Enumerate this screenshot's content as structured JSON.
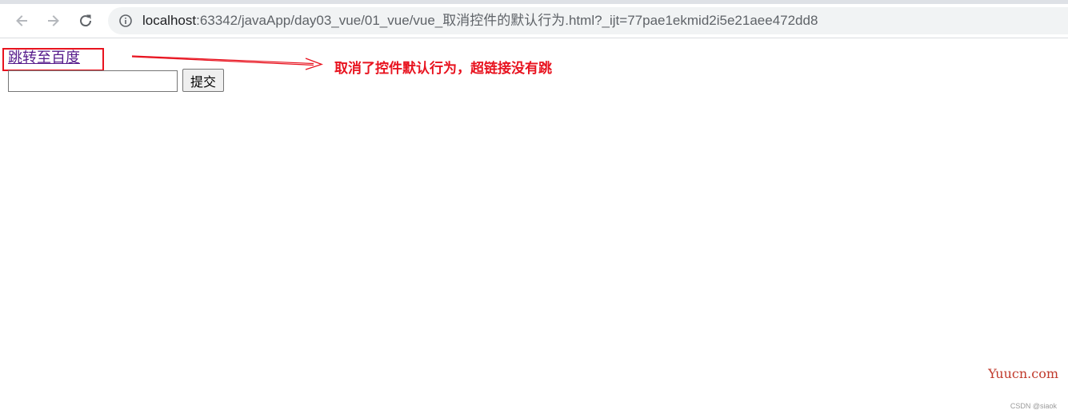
{
  "browser": {
    "url_host": "localhost",
    "url_rest": ":63342/javaApp/day03_vue/01_vue/vue_取消控件的默认行为.html?_ijt=77pae1ekmid2i5e21aee472dd8",
    "icons": {
      "back": "arrow-left-icon",
      "forward": "arrow-right-icon",
      "reload": "reload-icon",
      "info": "info-icon"
    }
  },
  "page": {
    "link_text": "跳转至百度",
    "input_value": "",
    "submit_label": "提交"
  },
  "annotation": {
    "text": "取消了控件默认行为，超链接没有跳",
    "color": "#e8131f"
  },
  "watermarks": {
    "site": "Yuucn.com",
    "author": "CSDN @siaok"
  }
}
